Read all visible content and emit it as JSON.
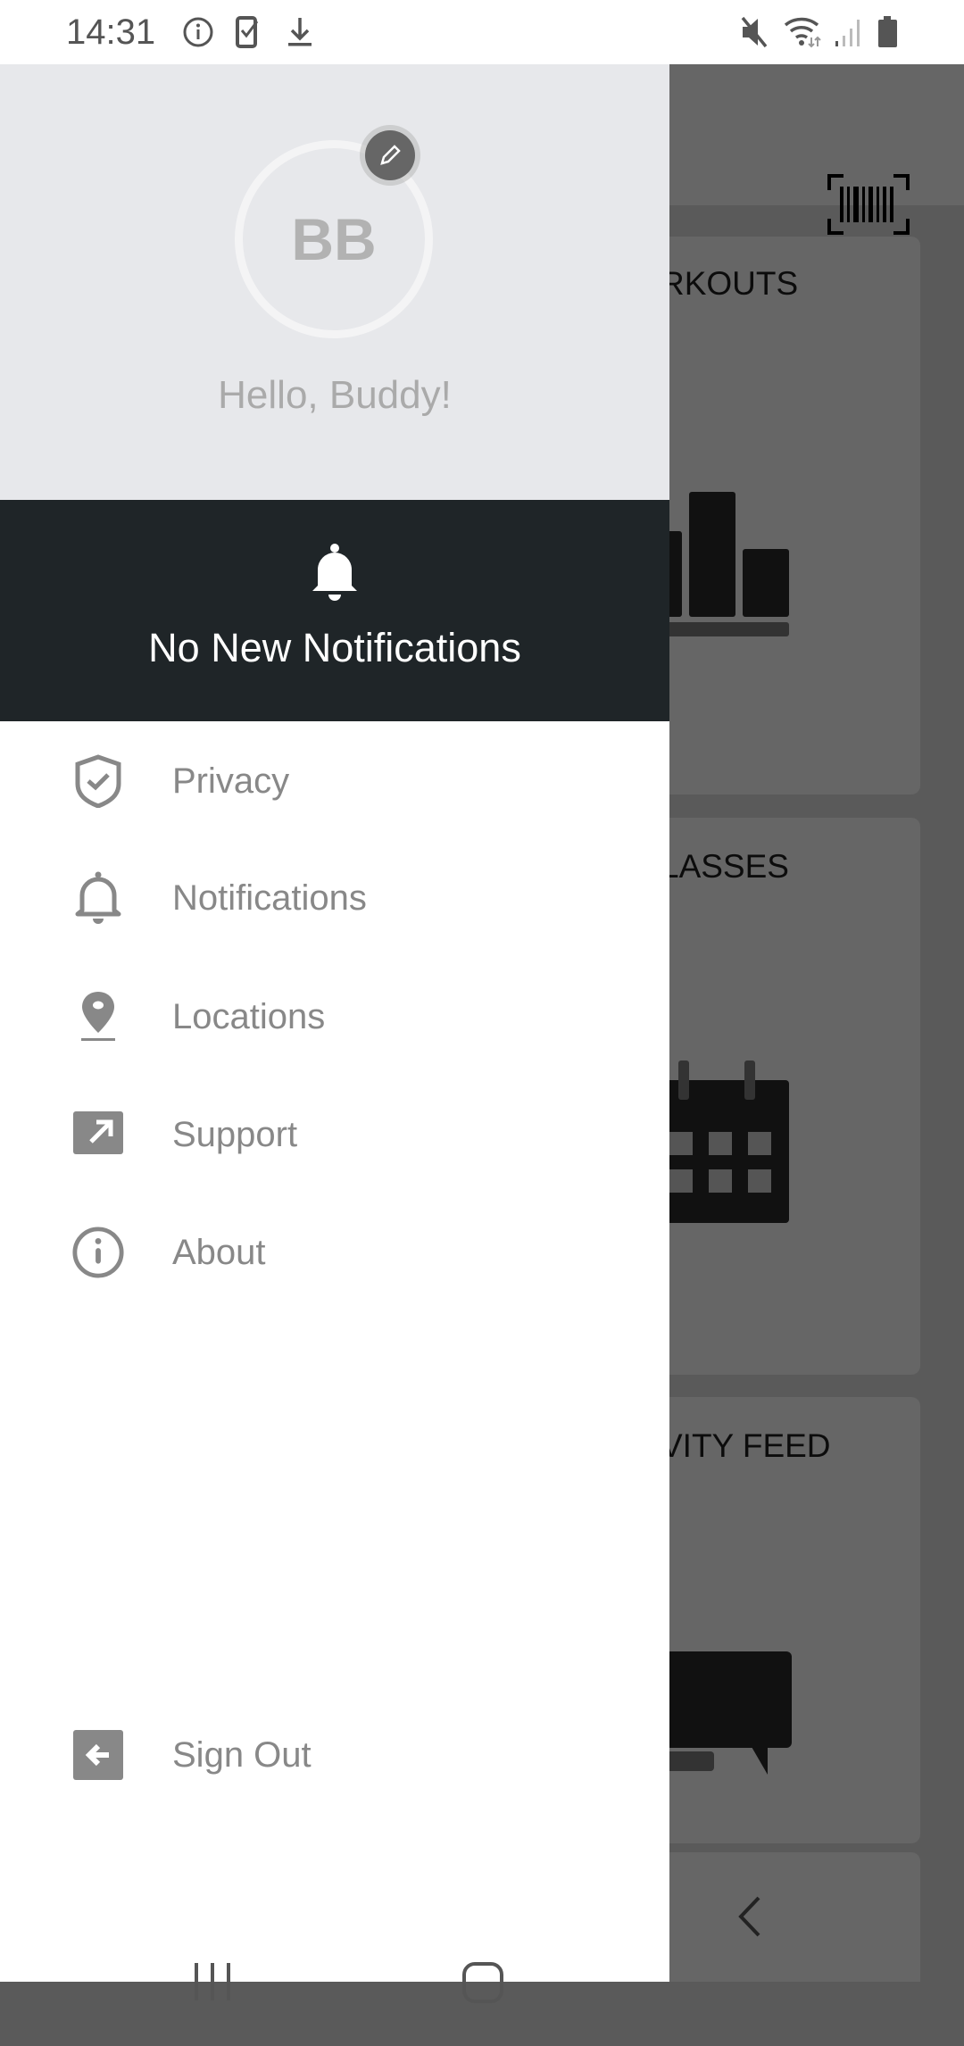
{
  "status_bar": {
    "time": "14:31",
    "left_icons": [
      "info-icon",
      "screenshot-check-icon",
      "download-icon"
    ],
    "right_icons": [
      "mute-icon",
      "wifi-icon",
      "signal-icon",
      "battery-icon"
    ]
  },
  "background": {
    "cards": [
      {
        "title": "WORKOUTS",
        "icon": "bar-chart-icon"
      },
      {
        "title": "CLASSES",
        "icon": "calendar-icon"
      },
      {
        "title": "ACTIVITY FEED",
        "icon": "chat-icon"
      }
    ],
    "visible_titles": [
      "RKOUTS",
      "LASSES",
      "VITY FEED"
    ],
    "action_icon": "barcode-icon"
  },
  "drawer": {
    "avatar_initials": "BB",
    "greeting": "Hello, Buddy!",
    "notification_banner": "No New Notifications",
    "items": [
      {
        "label": "Privacy",
        "icon": "shield-check-icon"
      },
      {
        "label": "Notifications",
        "icon": "bell-icon"
      },
      {
        "label": "Locations",
        "icon": "location-pin-icon"
      },
      {
        "label": "Support",
        "icon": "external-link-icon"
      },
      {
        "label": "About",
        "icon": "info-icon"
      }
    ],
    "sign_out": {
      "label": "Sign Out",
      "icon": "sign-out-icon"
    }
  },
  "colors": {
    "header_bg": "#e7e8eb",
    "banner_bg": "#1f2528",
    "icon_gray": "#888888",
    "scrim": "#666666"
  }
}
